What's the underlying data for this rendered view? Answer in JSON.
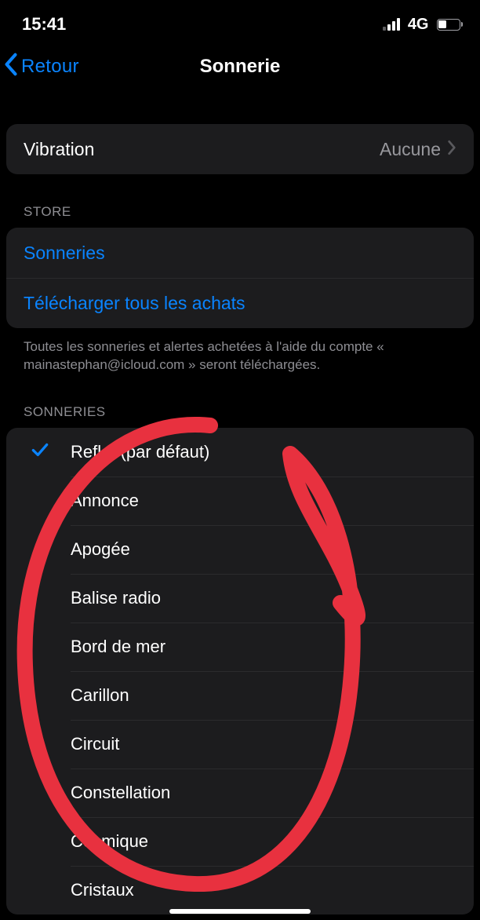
{
  "status": {
    "time": "15:41",
    "network": "4G"
  },
  "nav": {
    "back": "Retour",
    "title": "Sonnerie"
  },
  "vibration": {
    "label": "Vibration",
    "value": "Aucune"
  },
  "store": {
    "header": "STORE",
    "ringtones": "Sonneries",
    "download_all": "Télécharger tous les achats",
    "footer": "Toutes les sonneries et alertes achetées à l'aide du compte « mainastephan@icloud.com » seront téléchargées."
  },
  "ringtones": {
    "header": "SONNERIES",
    "items": [
      {
        "label": "Reflet (par défaut)",
        "selected": true
      },
      {
        "label": "Annonce",
        "selected": false
      },
      {
        "label": "Apogée",
        "selected": false
      },
      {
        "label": "Balise radio",
        "selected": false
      },
      {
        "label": "Bord de mer",
        "selected": false
      },
      {
        "label": "Carillon",
        "selected": false
      },
      {
        "label": "Circuit",
        "selected": false
      },
      {
        "label": "Constellation",
        "selected": false
      },
      {
        "label": "Cosmique",
        "selected": false
      },
      {
        "label": "Cristaux",
        "selected": false
      }
    ]
  }
}
